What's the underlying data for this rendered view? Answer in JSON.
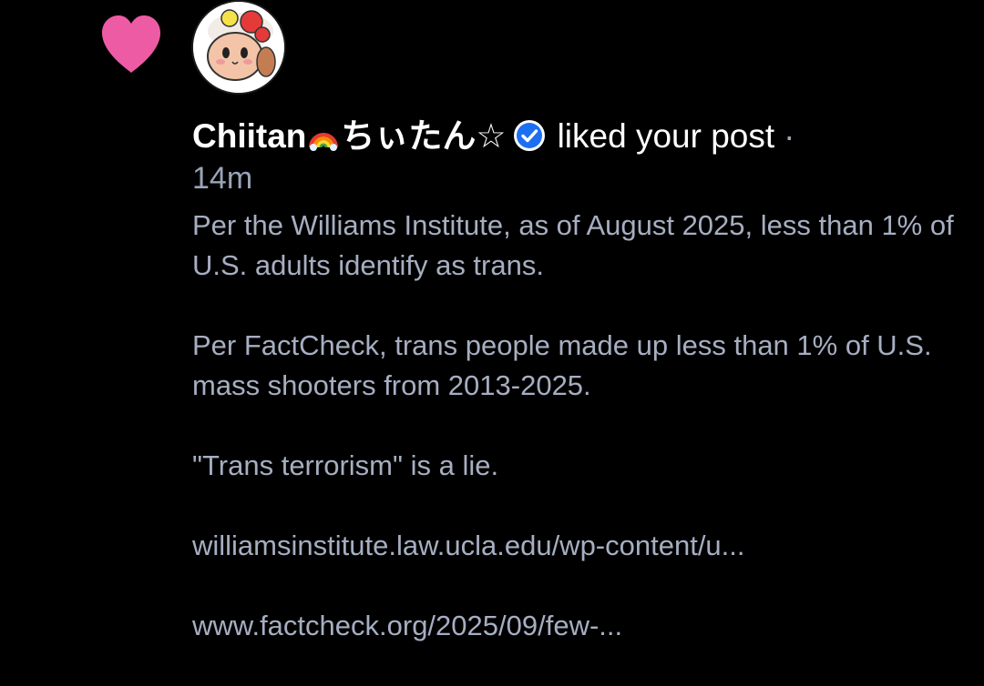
{
  "notification": {
    "type": "like",
    "display_name": "Chiitan",
    "display_name_suffix": "ちぃたん☆",
    "action_text": "liked your post",
    "separator": "·",
    "timestamp": "14m",
    "icons": {
      "heart": "heart-icon",
      "rainbow": "rainbow-emoji-icon",
      "verified": "verified-check-icon"
    },
    "colors": {
      "heart": "#EE5BA5",
      "verified": "#1D6FF2",
      "body_text": "#A6AEC1",
      "background": "#000000"
    }
  },
  "post": {
    "paragraphs": [
      "Per the Williams Institute, as of August 2025, less than 1% of U.S. adults identify as trans.",
      "Per FactCheck, trans people made up less than 1% of U.S. mass shooters from 2013-2025.",
      "\"Trans terrorism\" is a lie."
    ],
    "links": [
      "williamsinstitute.law.ucla.edu/wp-content/u...",
      "www.factcheck.org/2025/09/few-..."
    ]
  }
}
